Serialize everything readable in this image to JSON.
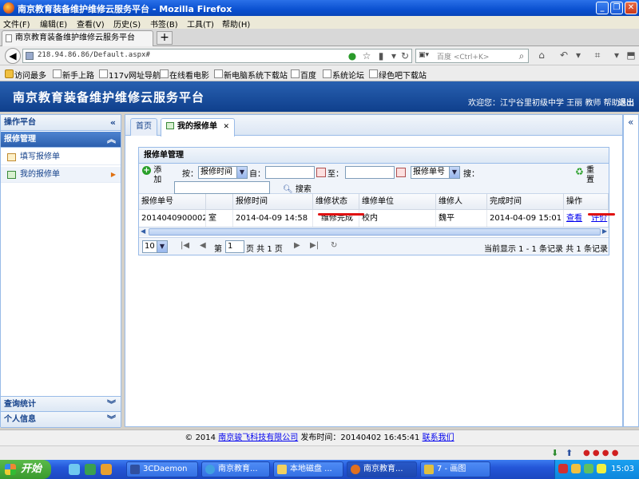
{
  "browser": {
    "window_title": "南京教育装备维护维修云服务平台 - Mozilla Firefox",
    "menus": [
      "文件(F)",
      "编辑(E)",
      "查看(V)",
      "历史(S)",
      "书签(B)",
      "工具(T)",
      "帮助(H)"
    ],
    "tab_title": "南京教育装备维护维修云服务平台",
    "new_tab": "+",
    "url": "218.94.86.86/Default.aspx#",
    "search_engine": "百度",
    "search_placeholder": "百度 <Ctrl+K>",
    "bookmarks": [
      "访问最多",
      "新手上路",
      "117v网址导航",
      "在线看电影",
      "新电脑系统下载站",
      "百度",
      "系统论坛",
      "绿色吧下载站"
    ]
  },
  "app": {
    "title": "南京教育装备维护维修云服务平台",
    "welcome": "欢迎您：江宁谷里初级中学 王丽 教师 帮助",
    "logout": "退出"
  },
  "sidebar": {
    "platform_header": "操作平台",
    "section_repair": "报修管理",
    "items": [
      {
        "label": "填写报修单"
      },
      {
        "label": "我的报修单"
      }
    ],
    "section_stats": "查询统计",
    "section_personal": "个人信息"
  },
  "tabs": {
    "home": "首页",
    "my_orders": "我的报修单"
  },
  "panel": {
    "title": "报修单管理",
    "add_label": "添加",
    "by_label": "按：",
    "sort_select": "报修时间",
    "from_label": "自：",
    "to_label": "至：",
    "field_select": "报修单号",
    "search_label": "搜：",
    "search_button": "搜索",
    "reset_label": "重置"
  },
  "grid": {
    "headers": [
      "报修单号",
      "",
      "报修时间",
      "维修状态",
      "维修单位",
      "维修人",
      "完成时间",
      "操作"
    ],
    "rows": [
      {
        "order_no": "20140409000026",
        "room": "室",
        "report_time": "2014-04-09 14:58",
        "status": "维修完成",
        "unit": "校内",
        "person": "魏平",
        "finish_time": "2014-04-09 15:01",
        "view": "查看",
        "rate": "评价"
      }
    ]
  },
  "pager": {
    "page_size": "10",
    "page_prefix": "第",
    "page_value": "1",
    "page_suffix": "页 共 1 页",
    "summary": "当前显示 1 - 1 条记录 共 1 条记录"
  },
  "footer": {
    "copyright": "© 2014",
    "company": "南京骏飞科技有限公司",
    "publish": "发布时间：20140402 16:45:41",
    "contact": "联系我们"
  },
  "taskbar": {
    "start": "开始",
    "buttons": [
      "3CDaemon",
      "南京教育...",
      "本地磁盘 ...",
      "南京教育...",
      "7 - 画图"
    ],
    "clock": "15:03"
  },
  "colors": {
    "header_blue": "#1a4c98",
    "link": "#0000ee",
    "annotation_red": "#e01010"
  }
}
